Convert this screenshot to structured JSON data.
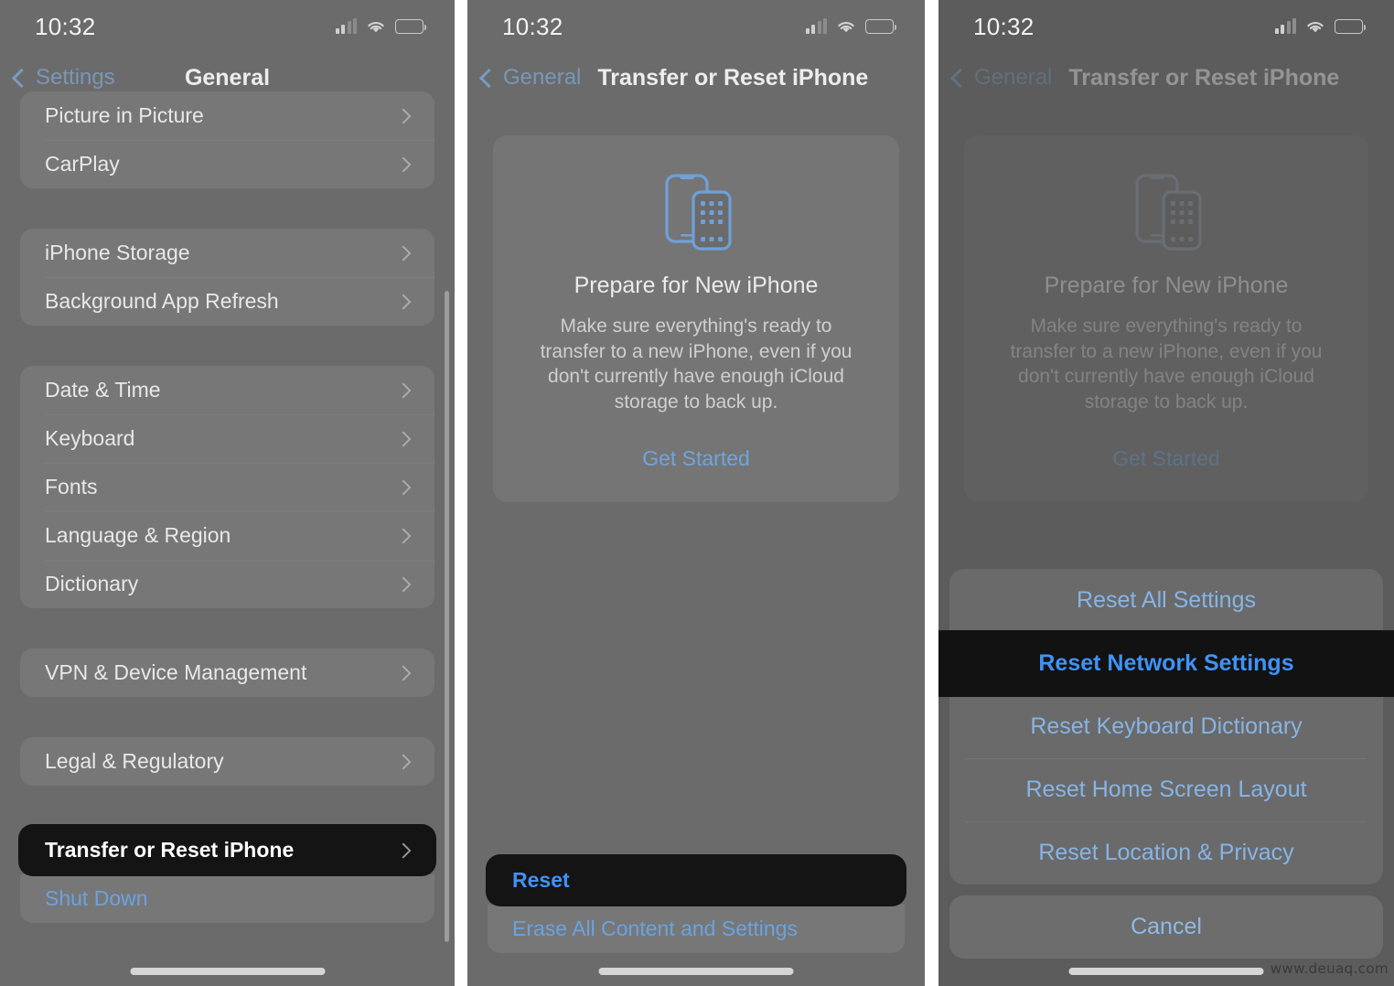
{
  "colors": {
    "panel_bg": "#6b6b6b",
    "highlight_bg": "#141414",
    "accent_blue": "#3f93f5",
    "muted_blue": "#86b4e6",
    "battery_yellow": "#e9d36a",
    "text_primary": "#e8e8e8"
  },
  "status_bar": {
    "time": "10:32",
    "cellular_icon": "cellular-bars-icon",
    "wifi_icon": "wifi-icon",
    "battery_icon": "battery-low-power-icon"
  },
  "panel1": {
    "nav": {
      "back_label": "Settings",
      "back_icon": "chevron-left-icon",
      "title": "General"
    },
    "groups": [
      {
        "rows": [
          {
            "label": "Picture in Picture",
            "accessory": "chevron-right-icon"
          },
          {
            "label": "CarPlay",
            "accessory": "chevron-right-icon"
          }
        ]
      },
      {
        "rows": [
          {
            "label": "iPhone Storage",
            "accessory": "chevron-right-icon"
          },
          {
            "label": "Background App Refresh",
            "accessory": "chevron-right-icon"
          }
        ]
      },
      {
        "rows": [
          {
            "label": "Date & Time",
            "accessory": "chevron-right-icon"
          },
          {
            "label": "Keyboard",
            "accessory": "chevron-right-icon"
          },
          {
            "label": "Fonts",
            "accessory": "chevron-right-icon"
          },
          {
            "label": "Language & Region",
            "accessory": "chevron-right-icon"
          },
          {
            "label": "Dictionary",
            "accessory": "chevron-right-icon"
          }
        ]
      },
      {
        "rows": [
          {
            "label": "VPN & Device Management",
            "accessory": "chevron-right-icon"
          }
        ]
      },
      {
        "rows": [
          {
            "label": "Legal & Regulatory",
            "accessory": "chevron-right-icon"
          }
        ]
      },
      {
        "rows": [
          {
            "label": "Transfer or Reset iPhone",
            "accessory": "chevron-right-icon",
            "highlighted": true
          },
          {
            "label": "Shut Down",
            "accessory": "",
            "style": "blue"
          }
        ]
      }
    ]
  },
  "panel2": {
    "nav": {
      "back_label": "General",
      "back_icon": "chevron-left-icon",
      "title": "Transfer or Reset iPhone"
    },
    "card": {
      "illustration": "two-iphones-transfer-icon",
      "title": "Prepare for New iPhone",
      "body": "Make sure everything's ready to transfer to a new iPhone, even if you don't currently have enough iCloud storage to back up.",
      "cta": "Get Started"
    },
    "bottom_rows": [
      {
        "label": "Reset",
        "highlighted": true
      },
      {
        "label": "Erase All Content and Settings",
        "highlighted": false
      }
    ]
  },
  "panel3": {
    "nav": {
      "back_label": "General",
      "back_icon": "chevron-left-icon",
      "title": "Transfer or Reset iPhone"
    },
    "card": {
      "illustration": "two-iphones-transfer-icon",
      "title": "Prepare for New iPhone",
      "body": "Make sure everything's ready to transfer to a new iPhone, even if you don't currently have enough iCloud storage to back up.",
      "cta": "Get Started"
    },
    "action_sheet": {
      "options": [
        {
          "label": "Reset All Settings",
          "highlighted": false
        },
        {
          "label": "Reset Network Settings",
          "highlighted": true
        },
        {
          "label": "Reset Keyboard Dictionary",
          "highlighted": false
        },
        {
          "label": "Reset Home Screen Layout",
          "highlighted": false
        },
        {
          "label": "Reset Location & Privacy",
          "highlighted": false
        }
      ],
      "cancel_label": "Cancel"
    }
  },
  "watermark": "www.deuaq.com"
}
